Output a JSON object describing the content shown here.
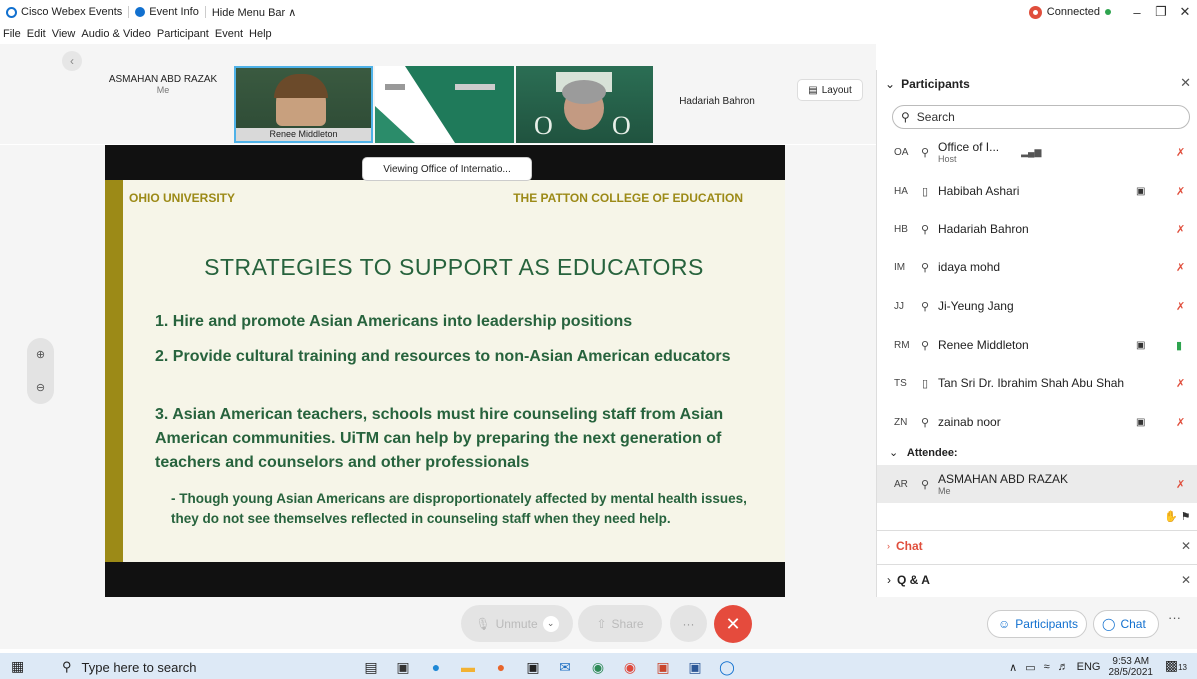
{
  "titlebar": {
    "app_name": "Cisco Webex Events",
    "event_info": "Event Info",
    "hide_menu": "Hide Menu Bar ∧",
    "connection": "Connected"
  },
  "menubar": [
    "File",
    "Edit",
    "View",
    "Audio & Video",
    "Participant",
    "Event",
    "Help"
  ],
  "video_strip": {
    "self_name": "ASMAHAN ABD RAZAK",
    "self_sub": "Me",
    "active_speaker": "Renee Middleton",
    "other_name": "Hadariah Bahron",
    "layout_label": "Layout"
  },
  "viewing_label": "Viewing Office of Internatio...",
  "slide": {
    "header_left": "OHIO UNIVERSITY",
    "header_right": "THE PATTON COLLEGE OF EDUCATION",
    "title": "STRATEGIES TO SUPPORT AS EDUCATORS",
    "point1": "1. Hire and promote Asian Americans into leadership positions",
    "point2": "2. Provide cultural training and resources to non-Asian American educators",
    "point3": "3. Asian American teachers, schools must hire counseling staff from Asian American communities. UiTM can help by preparing the next generation of teachers and counselors and other professionals",
    "point4": "- Though young Asian Americans are disproportionately affected by mental health issues, they do not see themselves reflected in counseling staff when they need help."
  },
  "controls": {
    "unmute": "Unmute",
    "share": "Share",
    "more": "···"
  },
  "panel": {
    "title": "Participants",
    "search_placeholder": "Search",
    "participants": [
      {
        "initials": "OA",
        "name": "Office of I...",
        "sub": "Host"
      },
      {
        "initials": "HA",
        "name": "Habibah Ashari",
        "sub": ""
      },
      {
        "initials": "HB",
        "name": "Hadariah Bahron",
        "sub": ""
      },
      {
        "initials": "IM",
        "name": "idaya mohd",
        "sub": ""
      },
      {
        "initials": "JJ",
        "name": "Ji-Yeung Jang",
        "sub": ""
      },
      {
        "initials": "RM",
        "name": "Renee Middleton",
        "sub": ""
      },
      {
        "initials": "TS",
        "name": "Tan Sri Dr. Ibrahim Shah Abu Shah",
        "sub": ""
      },
      {
        "initials": "ZN",
        "name": "zainab noor",
        "sub": ""
      }
    ],
    "attendee_header": "Attendee:",
    "attendee": {
      "initials": "AR",
      "name": "ASMAHAN ABD RAZAK",
      "sub": "Me"
    },
    "chat_label": "Chat",
    "qa_label": "Q & A"
  },
  "bottom_right": {
    "participants_btn": "Participants",
    "chat_btn": "Chat"
  },
  "taskbar": {
    "search_placeholder": "Type here to search",
    "lang": "ENG",
    "time": "9:53 AM",
    "date": "28/5/2021",
    "notif_count": "13"
  }
}
